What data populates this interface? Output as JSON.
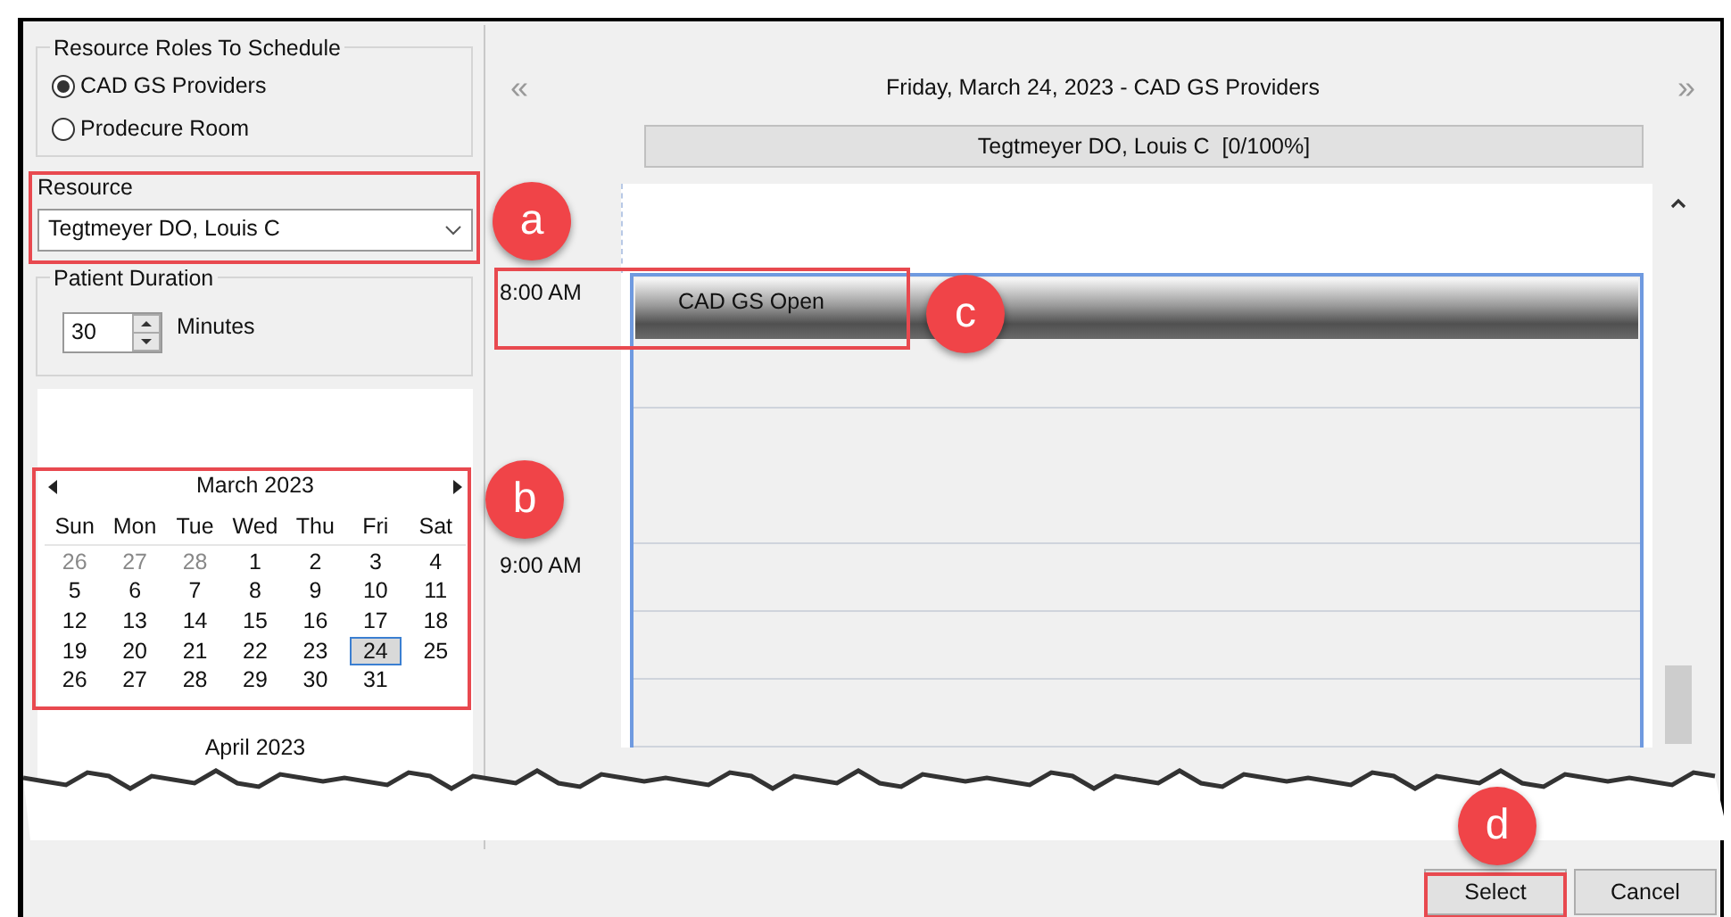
{
  "roles_group": {
    "title": "Resource Roles To Schedule",
    "options": [
      {
        "label": "CAD GS Providers",
        "selected": true
      },
      {
        "label": "Prodecure Room",
        "selected": false
      }
    ]
  },
  "resource": {
    "label": "Resource",
    "value": "Tegtmeyer DO, Louis C"
  },
  "duration": {
    "title": "Patient Duration",
    "value": "30",
    "unit": "Minutes"
  },
  "calendar": {
    "month": "March 2023",
    "weekdays": [
      "Sun",
      "Mon",
      "Tue",
      "Wed",
      "Thu",
      "Fri",
      "Sat"
    ],
    "days": [
      {
        "day": "26",
        "muted": true,
        "selected": false
      },
      {
        "day": "27",
        "muted": true,
        "selected": false
      },
      {
        "day": "28",
        "muted": true,
        "selected": false
      },
      {
        "day": "1",
        "muted": false,
        "selected": false
      },
      {
        "day": "2",
        "muted": false,
        "selected": false
      },
      {
        "day": "3",
        "muted": false,
        "selected": false
      },
      {
        "day": "4",
        "muted": false,
        "selected": false
      },
      {
        "day": "5",
        "muted": false,
        "selected": false
      },
      {
        "day": "6",
        "muted": false,
        "selected": false
      },
      {
        "day": "7",
        "muted": false,
        "selected": false
      },
      {
        "day": "8",
        "muted": false,
        "selected": false
      },
      {
        "day": "9",
        "muted": false,
        "selected": false
      },
      {
        "day": "10",
        "muted": false,
        "selected": false
      },
      {
        "day": "11",
        "muted": false,
        "selected": false
      },
      {
        "day": "12",
        "muted": false,
        "selected": false
      },
      {
        "day": "13",
        "muted": false,
        "selected": false
      },
      {
        "day": "14",
        "muted": false,
        "selected": false
      },
      {
        "day": "15",
        "muted": false,
        "selected": false
      },
      {
        "day": "16",
        "muted": false,
        "selected": false
      },
      {
        "day": "17",
        "muted": false,
        "selected": false
      },
      {
        "day": "18",
        "muted": false,
        "selected": false
      },
      {
        "day": "19",
        "muted": false,
        "selected": false
      },
      {
        "day": "20",
        "muted": false,
        "selected": false
      },
      {
        "day": "21",
        "muted": false,
        "selected": false
      },
      {
        "day": "22",
        "muted": false,
        "selected": false
      },
      {
        "day": "23",
        "muted": false,
        "selected": false
      },
      {
        "day": "24",
        "muted": false,
        "selected": true
      },
      {
        "day": "25",
        "muted": false,
        "selected": false
      },
      {
        "day": "26",
        "muted": false,
        "selected": false
      },
      {
        "day": "27",
        "muted": false,
        "selected": false
      },
      {
        "day": "28",
        "muted": false,
        "selected": false
      },
      {
        "day": "29",
        "muted": false,
        "selected": false
      },
      {
        "day": "30",
        "muted": false,
        "selected": false
      },
      {
        "day": "31",
        "muted": false,
        "selected": false
      }
    ],
    "next_month": "April 2023"
  },
  "schedule": {
    "prev": "«",
    "title": "Friday, March 24, 2023 - CAD GS Providers",
    "next": "»",
    "resource_header": "Tegtmeyer DO, Louis C  [0/100%]",
    "times": [
      "8:00 AM",
      "9:00 AM"
    ],
    "appointment": "CAD GS Open"
  },
  "buttons": [
    {
      "label": "Select"
    },
    {
      "label": "Cancel"
    }
  ],
  "callouts": [
    {
      "label": "a"
    },
    {
      "label": "b"
    },
    {
      "label": "c"
    },
    {
      "label": "d"
    }
  ]
}
